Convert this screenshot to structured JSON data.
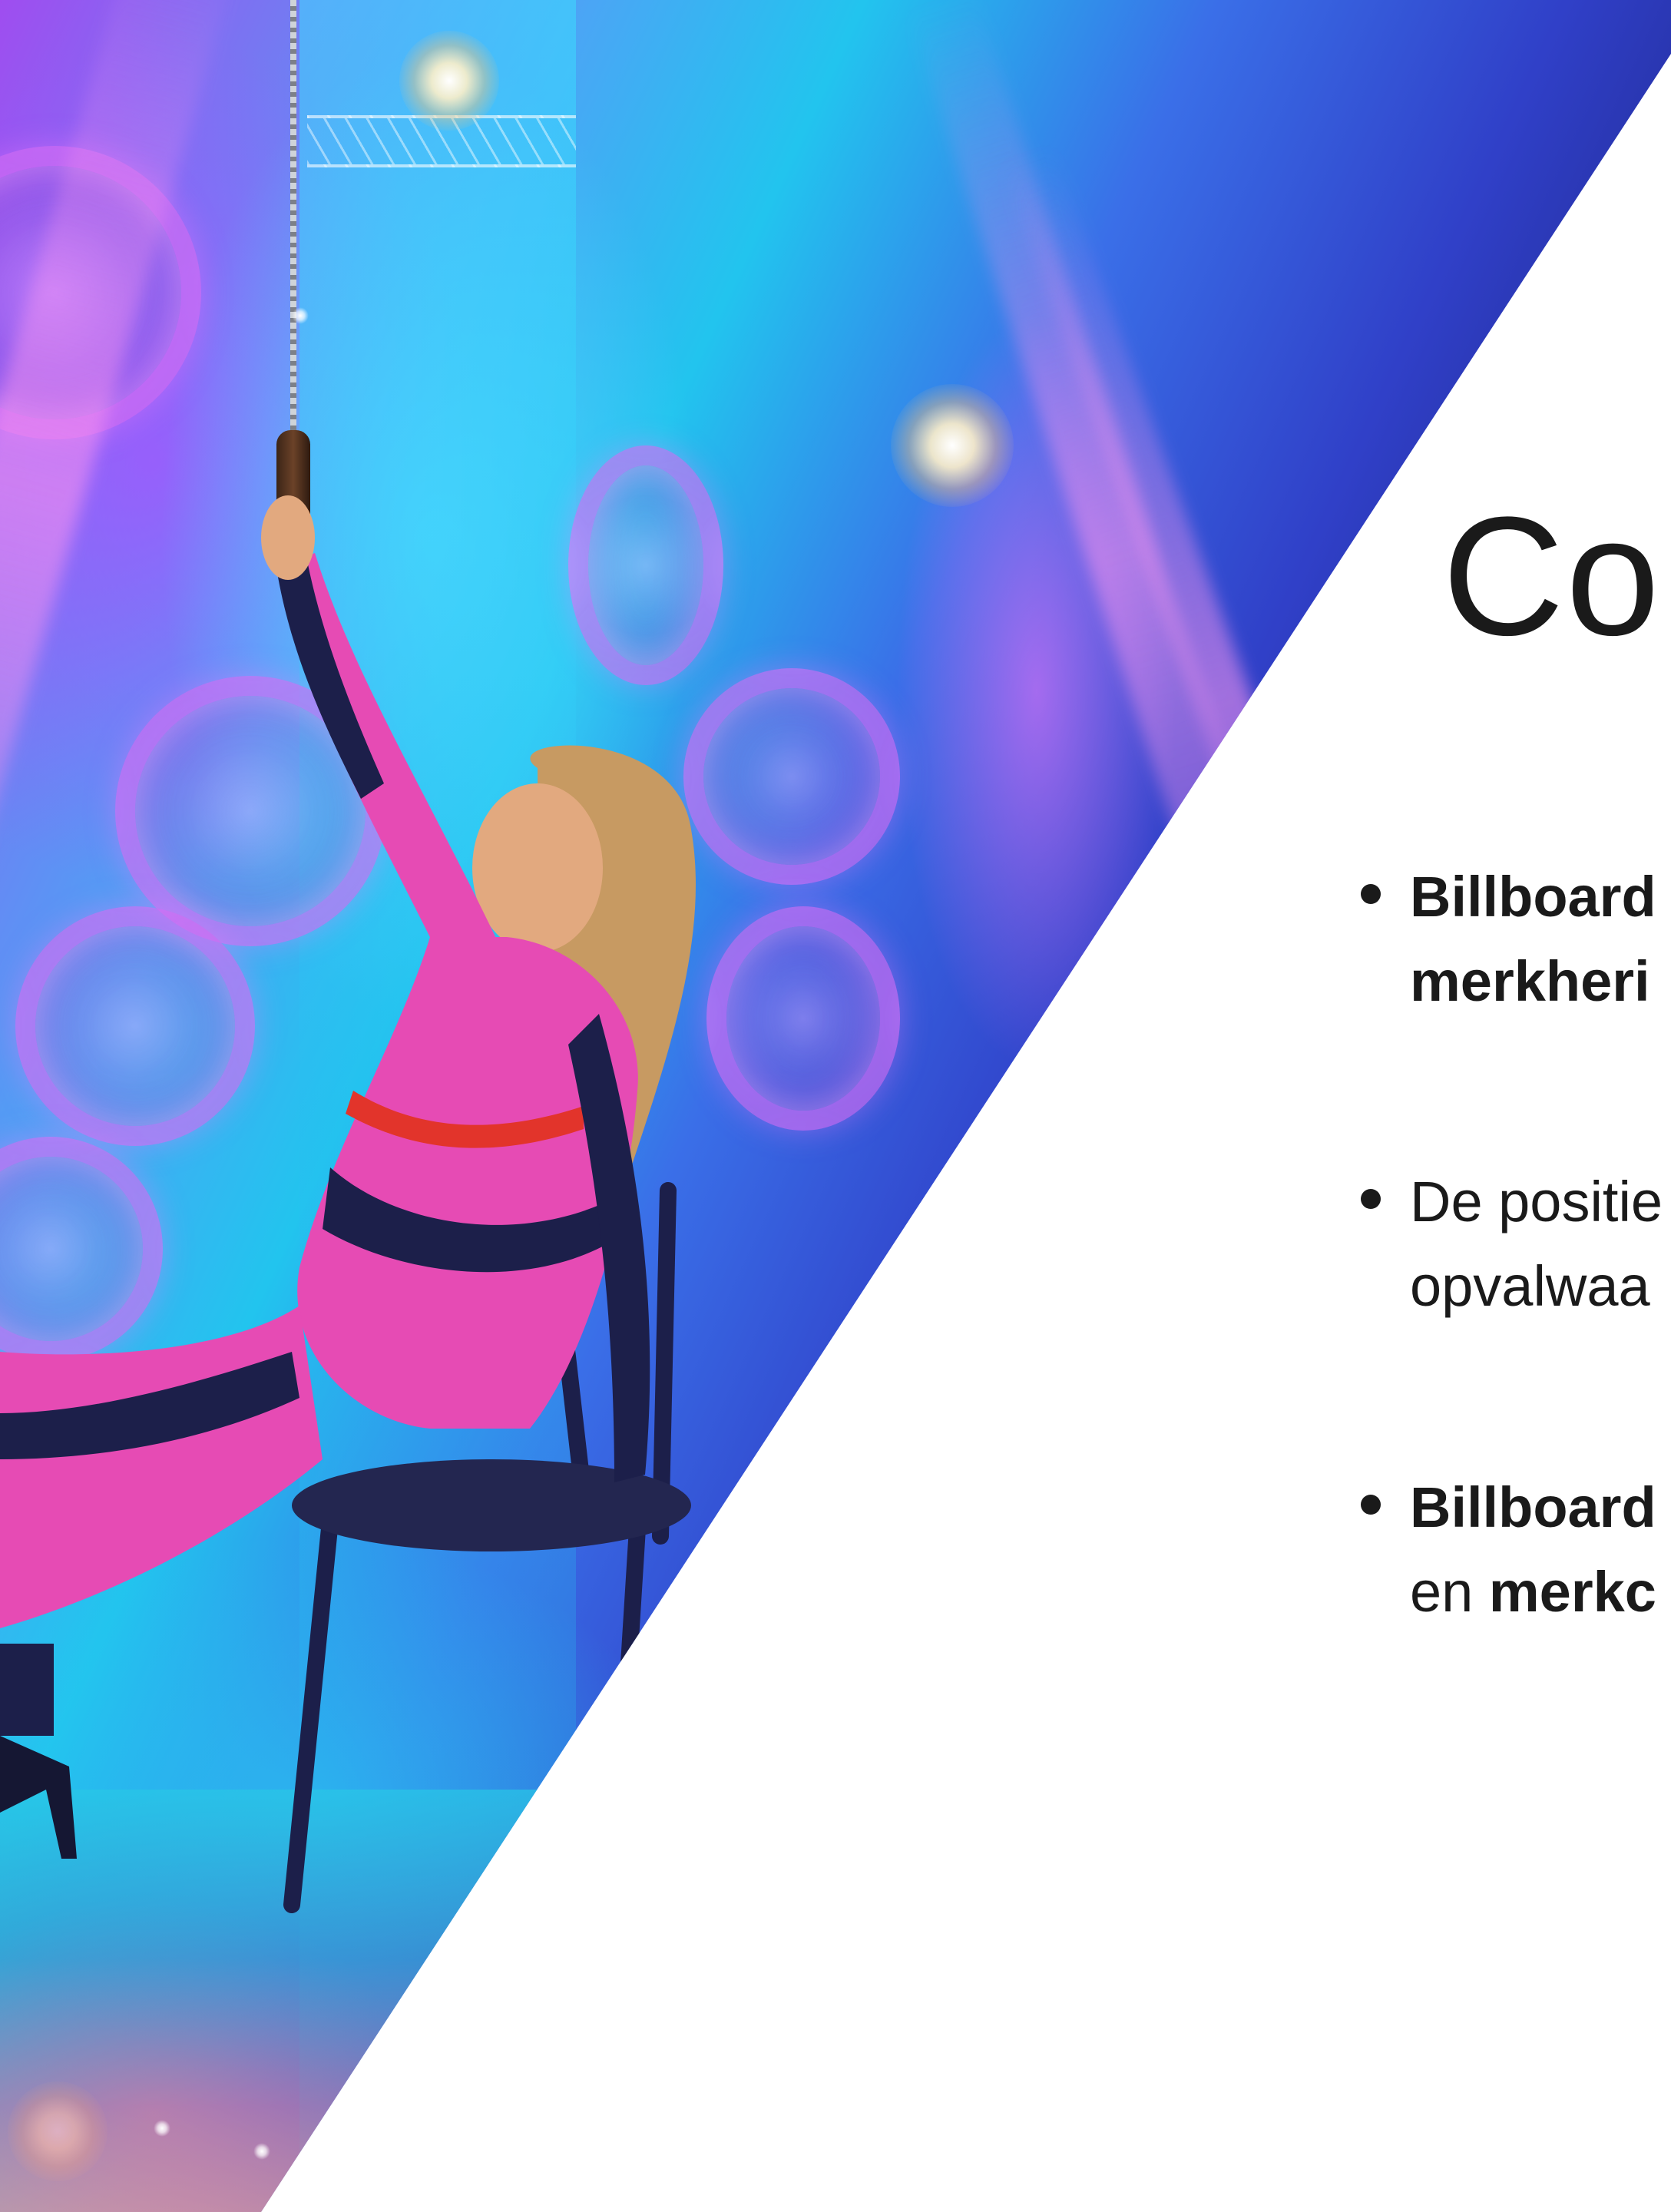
{
  "heading": "Co",
  "bullets": [
    {
      "lines": [
        [
          {
            "text": "Billboard",
            "bold": true
          }
        ],
        [
          {
            "text": "merkheri",
            "bold": true
          }
        ]
      ]
    },
    {
      "lines": [
        [
          {
            "text": "De positie",
            "bold": false
          }
        ],
        [
          {
            "text": "opvalwaa",
            "bold": false
          }
        ]
      ]
    },
    {
      "lines": [
        [
          {
            "text": "Billboard",
            "bold": true
          }
        ],
        [
          {
            "text": "en ",
            "bold": false
          },
          {
            "text": "merkc",
            "bold": true
          }
        ]
      ]
    }
  ],
  "colors": {
    "text": "#1a1a1a",
    "background": "#ffffff",
    "photo_accent_pink": "#e64bb4",
    "photo_accent_cyan": "#22c4ee",
    "photo_accent_navy": "#10105a"
  },
  "image": {
    "semantic": "performer-on-stage-photo"
  }
}
